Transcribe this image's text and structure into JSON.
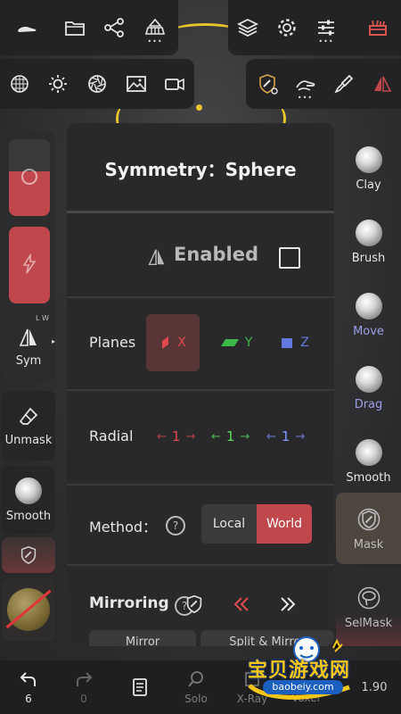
{
  "panel": {
    "title": "Symmetry：Sphere",
    "enabled_label": "Enabled",
    "enabled_checked": false,
    "planes_label": "Planes",
    "planes": [
      {
        "axis": "X",
        "active": true,
        "color": "#e0494f"
      },
      {
        "axis": "Y",
        "active": false,
        "color": "#3db94a"
      },
      {
        "axis": "Z",
        "active": false,
        "color": "#6479e0"
      }
    ],
    "radial_label": "Radial",
    "radial": [
      {
        "value": "1",
        "color": "#e0494f"
      },
      {
        "value": "1",
        "color": "#5fdc5f"
      },
      {
        "value": "1",
        "color": "#7f95ff"
      }
    ],
    "method_label": "Method：",
    "method_help": "?",
    "method_options": [
      "Local",
      "World"
    ],
    "method_selected": "World",
    "mirroring_label": "Mirroring",
    "mirroring_help": "?",
    "mirror_buttons": [
      "Mirror",
      "Split & Mirror"
    ]
  },
  "left_tools": {
    "sym_label": "Sym",
    "sym_badge": "L W",
    "unmask_label": "Unmask",
    "smooth_label": "Smooth"
  },
  "right_tools": [
    {
      "label": "Clay",
      "color": "#e6e6e6",
      "selected": false
    },
    {
      "label": "Brush",
      "color": "#e6e6e6",
      "selected": false
    },
    {
      "label": "Move",
      "color": "#9aa0e6",
      "selected": false
    },
    {
      "label": "Drag",
      "color": "#9aa0e6",
      "selected": false
    },
    {
      "label": "Smooth",
      "color": "#e6e6e6",
      "selected": false
    },
    {
      "label": "Mask",
      "color": "#bdbdbd",
      "selected": true
    },
    {
      "label": "SelMask",
      "color": "#bdbdbd",
      "selected": false
    }
  ],
  "bottom_bar": {
    "undo_count": "6",
    "redo_count": "0",
    "solo_label": "Solo",
    "xray_label": "X-Ray",
    "voxel_label": "Voxel",
    "value_label": "1.90"
  },
  "watermark": {
    "text": "宝贝游戏网",
    "url": "baobeiy.com"
  },
  "colors": {
    "accent_red": "#c0474b",
    "panel_bg": "#29292b",
    "highlight_yellow": "#e7c52a"
  }
}
